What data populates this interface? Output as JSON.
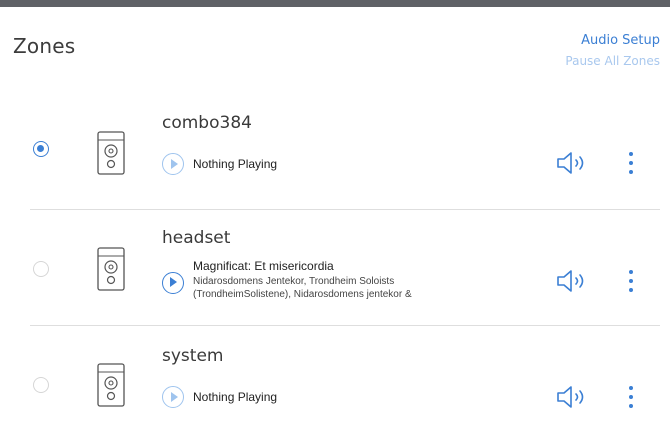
{
  "header": {
    "title": "Zones",
    "audio_setup_label": "Audio Setup",
    "pause_all_label": "Pause All Zones"
  },
  "zones": [
    {
      "name": "combo384",
      "selected": true,
      "now_playing": "Nothing Playing",
      "track_title": "",
      "track_artist": ""
    },
    {
      "name": "headset",
      "selected": false,
      "now_playing": "",
      "track_title": "Magnificat: Et misericordia",
      "track_artist": "Nidarosdomens Jentekor, Trondheim Soloists (TrondheimSolistene), Nidarosdomens jentekor &"
    },
    {
      "name": "system",
      "selected": false,
      "now_playing": "Nothing Playing",
      "track_title": "",
      "track_artist": ""
    }
  ],
  "colors": {
    "accent": "#3b7fd4",
    "accent_light": "#a9c8ee",
    "separator": "#dedede",
    "top_bar": "#5f6166"
  },
  "icons": {
    "speaker": "speaker-icon",
    "play": "play-icon",
    "volume": "volume-icon",
    "menu": "more-vertical-icon"
  }
}
